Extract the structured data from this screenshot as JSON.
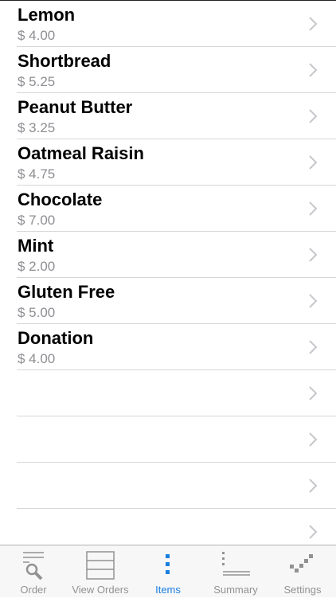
{
  "colors": {
    "accent": "#1a7fe0",
    "inactive": "#929292",
    "separator": "#d6d6d6"
  },
  "items": [
    {
      "name": "Lemon",
      "price": "$ 4.00"
    },
    {
      "name": "Shortbread",
      "price": "$ 5.25"
    },
    {
      "name": "Peanut Butter",
      "price": "$ 3.25"
    },
    {
      "name": "Oatmeal Raisin",
      "price": "$ 4.75"
    },
    {
      "name": "Chocolate",
      "price": "$ 7.00"
    },
    {
      "name": "Mint",
      "price": "$ 2.00"
    },
    {
      "name": "Gluten Free",
      "price": "$ 5.00"
    },
    {
      "name": "Donation",
      "price": "$ 4.00"
    },
    {
      "name": "",
      "price": ""
    },
    {
      "name": "",
      "price": ""
    },
    {
      "name": "",
      "price": ""
    },
    {
      "name": "",
      "price": ""
    }
  ],
  "tabbar": {
    "active": "items",
    "tabs": [
      {
        "id": "order",
        "label": "Order",
        "icon": "magnifier-list-icon"
      },
      {
        "id": "view_orders",
        "label": "View Orders",
        "icon": "grid-icon"
      },
      {
        "id": "items",
        "label": "Items",
        "icon": "vertical-dots-icon"
      },
      {
        "id": "summary",
        "label": "Summary",
        "icon": "chart-axis-icon"
      },
      {
        "id": "settings",
        "label": "Settings",
        "icon": "checkmark-dots-icon"
      }
    ]
  }
}
